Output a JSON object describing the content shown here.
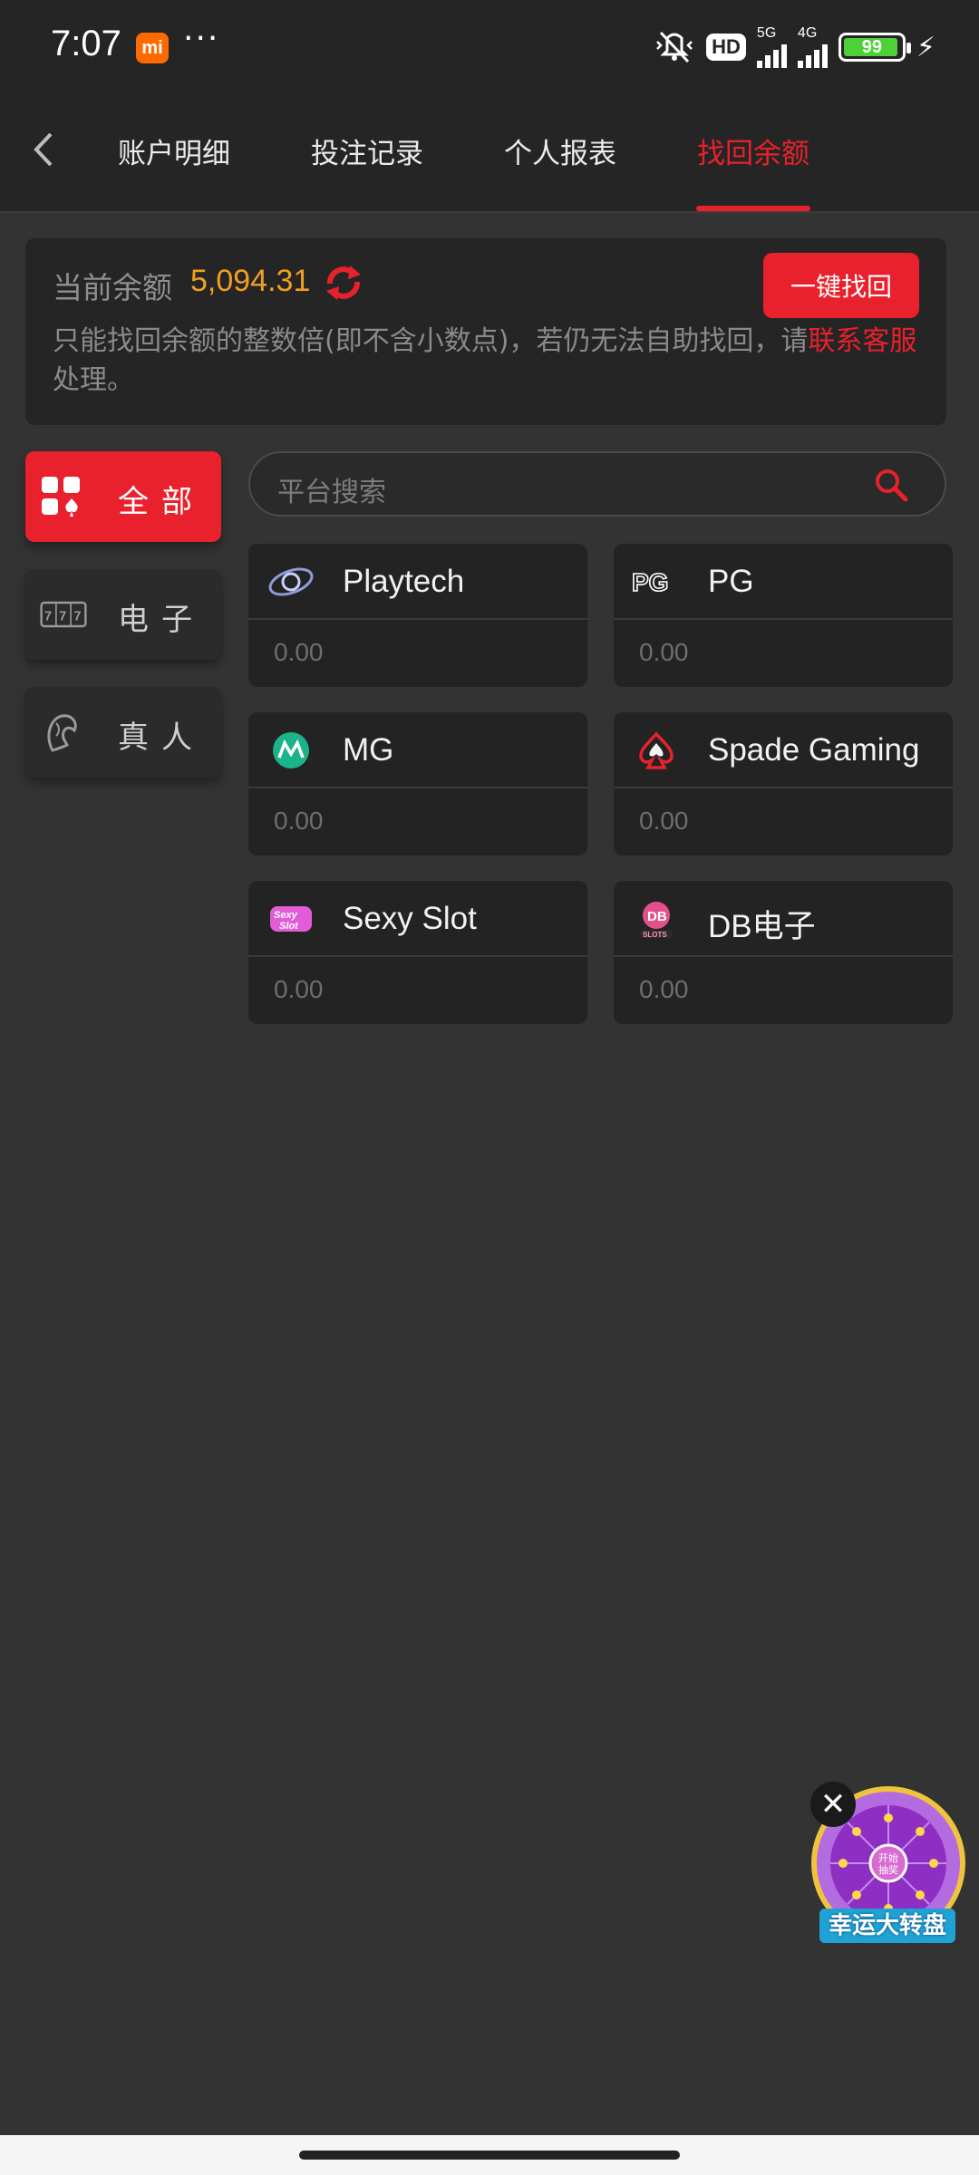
{
  "status_bar": {
    "time": "7:07",
    "app_badge": "mi",
    "dots": "···",
    "hd_label": "HD",
    "network_5g": "5G",
    "network_4g": "4G",
    "battery": "99"
  },
  "nav": {
    "tabs": [
      {
        "label": "账户明细"
      },
      {
        "label": "投注记录"
      },
      {
        "label": "个人报表"
      },
      {
        "label": "找回余额"
      }
    ],
    "active_tab": "找回余额"
  },
  "balance": {
    "label": "当前余额",
    "value": "5,094.31",
    "recover_button": "一键找回",
    "note_before": "只能找回余额的整数倍(即不含小数点)，若仍无法自助找回，请",
    "note_link": "联系客服",
    "note_after": "处理。"
  },
  "sidebar": {
    "items": [
      {
        "label": "全部",
        "icon": "grid-cards-icon",
        "active": true
      },
      {
        "label": "电子",
        "icon": "slot-777-icon",
        "active": false
      },
      {
        "label": "真人",
        "icon": "live-dealer-icon",
        "active": false
      }
    ]
  },
  "search": {
    "placeholder": "平台搜索"
  },
  "platforms": [
    {
      "name": "Playtech",
      "value": "0.00",
      "icon": "playtech-logo"
    },
    {
      "name": "PG",
      "value": "0.00",
      "icon": "pg-logo"
    },
    {
      "name": "MG",
      "value": "0.00",
      "icon": "mg-logo"
    },
    {
      "name": "Spade Gaming",
      "value": "0.00",
      "icon": "spade-gaming-logo"
    },
    {
      "name": "Sexy Slot",
      "value": "0.00",
      "icon": "sexy-slot-logo"
    },
    {
      "name": "DB电子",
      "value": "0.00",
      "icon": "db-slots-logo"
    }
  ],
  "promo": {
    "label": "幸运大转盘",
    "center_text": "开始抽奖",
    "close": "✕"
  },
  "colors": {
    "accent": "#e8212c",
    "balance": "#f0a020",
    "background": "#333333",
    "panel": "#252525"
  }
}
